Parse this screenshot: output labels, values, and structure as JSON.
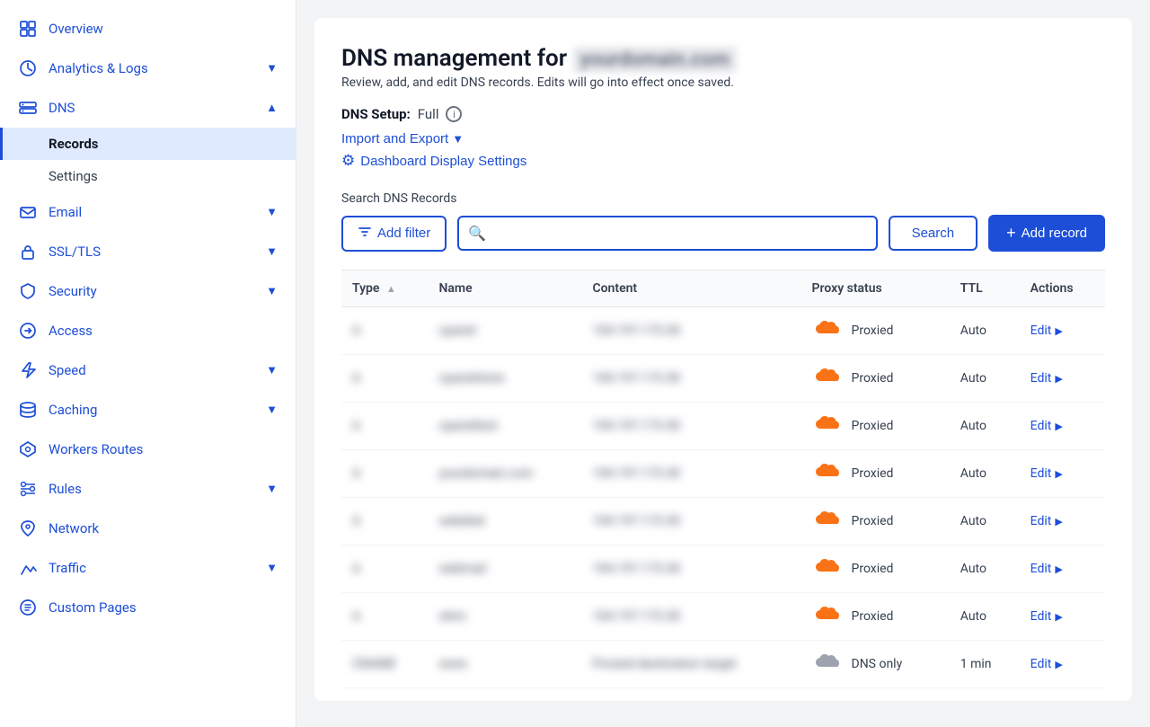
{
  "sidebar": {
    "items": [
      {
        "id": "overview",
        "label": "Overview",
        "icon": "grid",
        "hasChevron": false
      },
      {
        "id": "analytics-logs",
        "label": "Analytics & Logs",
        "icon": "chart",
        "hasChevron": true
      },
      {
        "id": "dns",
        "label": "DNS",
        "icon": "dns",
        "hasChevron": true,
        "expanded": true,
        "children": [
          {
            "id": "records",
            "label": "Records",
            "active": true
          },
          {
            "id": "settings",
            "label": "Settings"
          }
        ]
      },
      {
        "id": "email",
        "label": "Email",
        "icon": "email",
        "hasChevron": true
      },
      {
        "id": "ssl-tls",
        "label": "SSL/TLS",
        "icon": "lock",
        "hasChevron": true
      },
      {
        "id": "security",
        "label": "Security",
        "icon": "shield",
        "hasChevron": true
      },
      {
        "id": "access",
        "label": "Access",
        "icon": "arrow",
        "hasChevron": false
      },
      {
        "id": "speed",
        "label": "Speed",
        "icon": "bolt",
        "hasChevron": true
      },
      {
        "id": "caching",
        "label": "Caching",
        "icon": "cache",
        "hasChevron": true
      },
      {
        "id": "workers-routes",
        "label": "Workers Routes",
        "icon": "workers",
        "hasChevron": false
      },
      {
        "id": "rules",
        "label": "Rules",
        "icon": "rules",
        "hasChevron": true
      },
      {
        "id": "network",
        "label": "Network",
        "icon": "network",
        "hasChevron": false
      },
      {
        "id": "traffic",
        "label": "Traffic",
        "icon": "traffic",
        "hasChevron": true
      },
      {
        "id": "custom-pages",
        "label": "Custom Pages",
        "icon": "pages",
        "hasChevron": false
      }
    ]
  },
  "main": {
    "title": "DNS management for",
    "domain": "yourdomain.com",
    "subtitle": "Review, add, and edit DNS records. Edits will go into effect once saved.",
    "dns_setup_label": "DNS Setup:",
    "dns_setup_value": "Full",
    "import_export_label": "Import and Export",
    "dashboard_settings_label": "Dashboard Display Settings",
    "search": {
      "label": "Search DNS Records",
      "placeholder": "",
      "add_filter_label": "Add filter",
      "search_button_label": "Search",
      "add_record_label": "Add record"
    },
    "table": {
      "columns": [
        "Type ▲",
        "Name",
        "Content",
        "Proxy status",
        "TTL",
        "Actions"
      ],
      "rows": [
        {
          "type": "A",
          "name": "cpanel",
          "content": "104.197.173.30",
          "proxy": "Proxied",
          "ttl": "Auto",
          "action": "Edit"
        },
        {
          "type": "A",
          "name": "cpanelstore",
          "content": "104.197.173.30",
          "proxy": "Proxied",
          "ttl": "Auto",
          "action": "Edit"
        },
        {
          "type": "A",
          "name": "cpaneltest",
          "content": "104.197.173.30",
          "proxy": "Proxied",
          "ttl": "Auto",
          "action": "Edit"
        },
        {
          "type": "A",
          "name": "yourdomain.com",
          "content": "104.197.173.30",
          "proxy": "Proxied",
          "ttl": "Auto",
          "action": "Edit"
        },
        {
          "type": "A",
          "name": "webdisk",
          "content": "104.197.173.30",
          "proxy": "Proxied",
          "ttl": "Auto",
          "action": "Edit"
        },
        {
          "type": "A",
          "name": "webmail",
          "content": "104.197.173.30",
          "proxy": "Proxied",
          "ttl": "Auto",
          "action": "Edit"
        },
        {
          "type": "A",
          "name": "whm",
          "content": "104.197.173.30",
          "proxy": "Proxied",
          "ttl": "Auto",
          "action": "Edit"
        },
        {
          "type": "CNAME",
          "name": "www",
          "content": "Proxied destination target",
          "proxy": "DNS only",
          "ttl": "1 min",
          "action": "Edit"
        }
      ]
    }
  },
  "colors": {
    "blue": "#1d4ed8",
    "orange_cloud": "#f97316",
    "sidebar_active_bg": "#e0eaff"
  }
}
